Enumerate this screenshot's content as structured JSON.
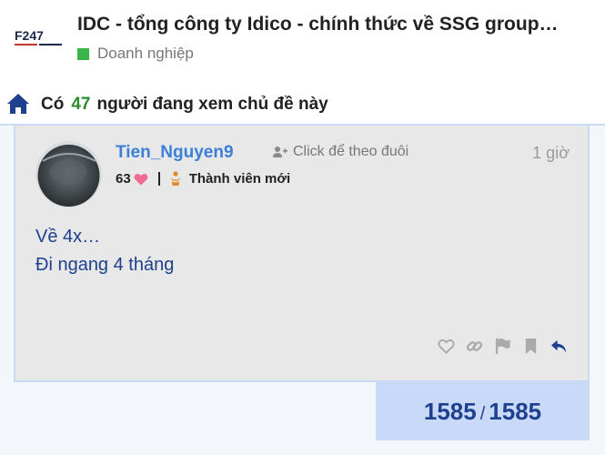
{
  "header": {
    "logo_text": "F247",
    "title": "IDC - tổng công ty Idico - chính thức về SSG group…",
    "category": {
      "label": "Doanh nghiệp",
      "color": "#3ab54a"
    }
  },
  "viewers": {
    "icon": "home-icon",
    "prefix": "Có",
    "count": "47",
    "suffix": "người đang xem chủ đề này"
  },
  "post": {
    "username": "Tien_Nguyen9",
    "follow_label": "Click để theo đuôi",
    "time": "1 giờ",
    "likes": "63",
    "rank": "Thành viên mới",
    "body": [
      "Về 4x…",
      "Đi ngang 4 tháng"
    ],
    "actions": [
      "heart-icon",
      "link-icon",
      "flag-icon",
      "bookmark-icon",
      "reply-icon"
    ]
  },
  "progress": {
    "current": "1585",
    "separator": "/",
    "total": "1585"
  },
  "colors": {
    "accent": "#3c7fd6",
    "post_text": "#1f3f8f",
    "viewer_count": "#2e8b2e",
    "heart": "#f06b94",
    "progress_bg": "#c9daf8"
  }
}
